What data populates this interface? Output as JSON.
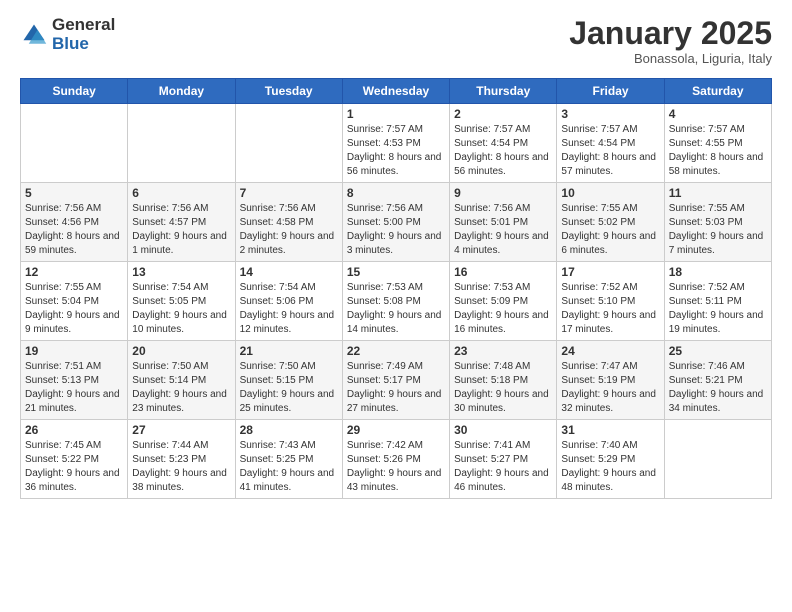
{
  "header": {
    "logo_general": "General",
    "logo_blue": "Blue",
    "month_title": "January 2025",
    "location": "Bonassola, Liguria, Italy"
  },
  "weekdays": [
    "Sunday",
    "Monday",
    "Tuesday",
    "Wednesday",
    "Thursday",
    "Friday",
    "Saturday"
  ],
  "weeks": [
    [
      {
        "day": "",
        "sunrise": "",
        "sunset": "",
        "daylight": ""
      },
      {
        "day": "",
        "sunrise": "",
        "sunset": "",
        "daylight": ""
      },
      {
        "day": "",
        "sunrise": "",
        "sunset": "",
        "daylight": ""
      },
      {
        "day": "1",
        "sunrise": "Sunrise: 7:57 AM",
        "sunset": "Sunset: 4:53 PM",
        "daylight": "Daylight: 8 hours and 56 minutes."
      },
      {
        "day": "2",
        "sunrise": "Sunrise: 7:57 AM",
        "sunset": "Sunset: 4:54 PM",
        "daylight": "Daylight: 8 hours and 56 minutes."
      },
      {
        "day": "3",
        "sunrise": "Sunrise: 7:57 AM",
        "sunset": "Sunset: 4:54 PM",
        "daylight": "Daylight: 8 hours and 57 minutes."
      },
      {
        "day": "4",
        "sunrise": "Sunrise: 7:57 AM",
        "sunset": "Sunset: 4:55 PM",
        "daylight": "Daylight: 8 hours and 58 minutes."
      }
    ],
    [
      {
        "day": "5",
        "sunrise": "Sunrise: 7:56 AM",
        "sunset": "Sunset: 4:56 PM",
        "daylight": "Daylight: 8 hours and 59 minutes."
      },
      {
        "day": "6",
        "sunrise": "Sunrise: 7:56 AM",
        "sunset": "Sunset: 4:57 PM",
        "daylight": "Daylight: 9 hours and 1 minute."
      },
      {
        "day": "7",
        "sunrise": "Sunrise: 7:56 AM",
        "sunset": "Sunset: 4:58 PM",
        "daylight": "Daylight: 9 hours and 2 minutes."
      },
      {
        "day": "8",
        "sunrise": "Sunrise: 7:56 AM",
        "sunset": "Sunset: 5:00 PM",
        "daylight": "Daylight: 9 hours and 3 minutes."
      },
      {
        "day": "9",
        "sunrise": "Sunrise: 7:56 AM",
        "sunset": "Sunset: 5:01 PM",
        "daylight": "Daylight: 9 hours and 4 minutes."
      },
      {
        "day": "10",
        "sunrise": "Sunrise: 7:55 AM",
        "sunset": "Sunset: 5:02 PM",
        "daylight": "Daylight: 9 hours and 6 minutes."
      },
      {
        "day": "11",
        "sunrise": "Sunrise: 7:55 AM",
        "sunset": "Sunset: 5:03 PM",
        "daylight": "Daylight: 9 hours and 7 minutes."
      }
    ],
    [
      {
        "day": "12",
        "sunrise": "Sunrise: 7:55 AM",
        "sunset": "Sunset: 5:04 PM",
        "daylight": "Daylight: 9 hours and 9 minutes."
      },
      {
        "day": "13",
        "sunrise": "Sunrise: 7:54 AM",
        "sunset": "Sunset: 5:05 PM",
        "daylight": "Daylight: 9 hours and 10 minutes."
      },
      {
        "day": "14",
        "sunrise": "Sunrise: 7:54 AM",
        "sunset": "Sunset: 5:06 PM",
        "daylight": "Daylight: 9 hours and 12 minutes."
      },
      {
        "day": "15",
        "sunrise": "Sunrise: 7:53 AM",
        "sunset": "Sunset: 5:08 PM",
        "daylight": "Daylight: 9 hours and 14 minutes."
      },
      {
        "day": "16",
        "sunrise": "Sunrise: 7:53 AM",
        "sunset": "Sunset: 5:09 PM",
        "daylight": "Daylight: 9 hours and 16 minutes."
      },
      {
        "day": "17",
        "sunrise": "Sunrise: 7:52 AM",
        "sunset": "Sunset: 5:10 PM",
        "daylight": "Daylight: 9 hours and 17 minutes."
      },
      {
        "day": "18",
        "sunrise": "Sunrise: 7:52 AM",
        "sunset": "Sunset: 5:11 PM",
        "daylight": "Daylight: 9 hours and 19 minutes."
      }
    ],
    [
      {
        "day": "19",
        "sunrise": "Sunrise: 7:51 AM",
        "sunset": "Sunset: 5:13 PM",
        "daylight": "Daylight: 9 hours and 21 minutes."
      },
      {
        "day": "20",
        "sunrise": "Sunrise: 7:50 AM",
        "sunset": "Sunset: 5:14 PM",
        "daylight": "Daylight: 9 hours and 23 minutes."
      },
      {
        "day": "21",
        "sunrise": "Sunrise: 7:50 AM",
        "sunset": "Sunset: 5:15 PM",
        "daylight": "Daylight: 9 hours and 25 minutes."
      },
      {
        "day": "22",
        "sunrise": "Sunrise: 7:49 AM",
        "sunset": "Sunset: 5:17 PM",
        "daylight": "Daylight: 9 hours and 27 minutes."
      },
      {
        "day": "23",
        "sunrise": "Sunrise: 7:48 AM",
        "sunset": "Sunset: 5:18 PM",
        "daylight": "Daylight: 9 hours and 30 minutes."
      },
      {
        "day": "24",
        "sunrise": "Sunrise: 7:47 AM",
        "sunset": "Sunset: 5:19 PM",
        "daylight": "Daylight: 9 hours and 32 minutes."
      },
      {
        "day": "25",
        "sunrise": "Sunrise: 7:46 AM",
        "sunset": "Sunset: 5:21 PM",
        "daylight": "Daylight: 9 hours and 34 minutes."
      }
    ],
    [
      {
        "day": "26",
        "sunrise": "Sunrise: 7:45 AM",
        "sunset": "Sunset: 5:22 PM",
        "daylight": "Daylight: 9 hours and 36 minutes."
      },
      {
        "day": "27",
        "sunrise": "Sunrise: 7:44 AM",
        "sunset": "Sunset: 5:23 PM",
        "daylight": "Daylight: 9 hours and 38 minutes."
      },
      {
        "day": "28",
        "sunrise": "Sunrise: 7:43 AM",
        "sunset": "Sunset: 5:25 PM",
        "daylight": "Daylight: 9 hours and 41 minutes."
      },
      {
        "day": "29",
        "sunrise": "Sunrise: 7:42 AM",
        "sunset": "Sunset: 5:26 PM",
        "daylight": "Daylight: 9 hours and 43 minutes."
      },
      {
        "day": "30",
        "sunrise": "Sunrise: 7:41 AM",
        "sunset": "Sunset: 5:27 PM",
        "daylight": "Daylight: 9 hours and 46 minutes."
      },
      {
        "day": "31",
        "sunrise": "Sunrise: 7:40 AM",
        "sunset": "Sunset: 5:29 PM",
        "daylight": "Daylight: 9 hours and 48 minutes."
      },
      {
        "day": "",
        "sunrise": "",
        "sunset": "",
        "daylight": ""
      }
    ]
  ]
}
